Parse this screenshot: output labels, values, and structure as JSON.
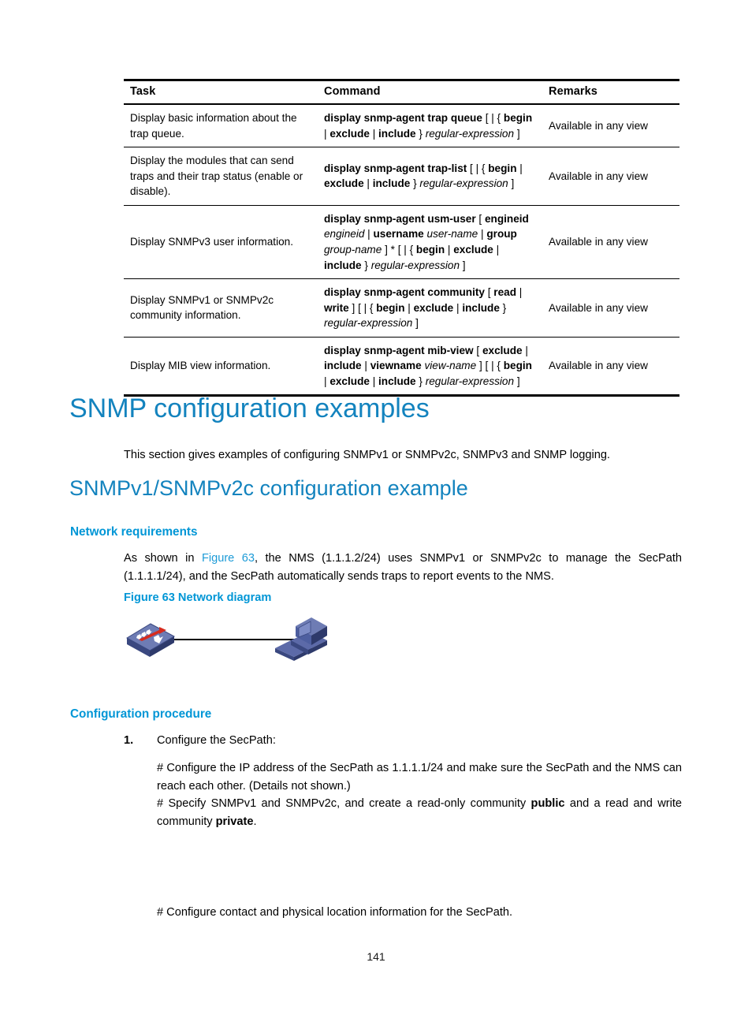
{
  "table": {
    "headers": [
      "Task",
      "Command",
      "Remarks"
    ],
    "rows": [
      {
        "task": "Display basic information about the trap queue.",
        "command_html": "<b>display snmp-agent trap queue</b> [ | { <b>begin</b> | <b>exclude</b> | <b>include</b> } <i>regular-expression</i> ]",
        "remarks": "Available in any view"
      },
      {
        "task": "Display the modules that can send traps and their trap status (enable or disable).",
        "command_html": "<b>display snmp-agent trap-list</b> [ | { <b>begin</b> | <b>exclude</b> | <b>include</b> } <i>regular-expression</i> ]",
        "remarks": "Available in any view"
      },
      {
        "task": "Display SNMPv3 user information.",
        "command_html": "<b>display snmp-agent usm-user</b> [ <b>engineid</b> <i>engineid</i> | <b>username</b> <i>user-name</i> | <b>group</b> <i>group-name</i> ] * [ | { <b>begin</b> | <b>exclude</b> | <b>include</b> } <i>regular-expression</i> ]",
        "remarks": "Available in any view"
      },
      {
        "task": "Display SNMPv1 or SNMPv2c community information.",
        "command_html": "<b>display snmp-agent community</b> [ <b>read</b> | <b>write</b> ] [ | { <b>begin</b> | <b>exclude</b> | <b>include</b> } <i>regular-expression</i> ]",
        "remarks": "Available in any view"
      },
      {
        "task": "Display MIB view information.",
        "command_html": "<b>display snmp-agent mib-view</b> [ <b>exclude</b> | <b>include</b> | <b>viewname</b> <i>view-name</i> ] [ | { <b>begin</b> | <b>exclude</b> | <b>include</b> } <i>regular-expression</i> ]",
        "remarks": "Available in any view"
      }
    ]
  },
  "headings": {
    "h1": "SNMP configuration examples",
    "h2": "SNMPv1/SNMPv2c configuration example",
    "network_requirements": "Network requirements",
    "configuration_procedure": "Configuration procedure"
  },
  "body": {
    "intro": "This section gives examples of configuring SNMPv1 or SNMPv2c, SNMPv3 and SNMP logging.",
    "requirements_html": "As shown in <span class=\"xref\">Figure 63</span>, the NMS (1.1.1.2/24) uses SNMPv1 or SNMPv2c to manage the SecPath (1.1.1.1/24), and the SecPath automatically sends traps to report events to the NMS.",
    "figure_caption": "Figure 63 Network diagram",
    "step_1_number": "1.",
    "step_1_text": "Configure the SecPath:",
    "sub_1": "# Configure the IP address of the SecPath as 1.1.1.1/24 and make sure the SecPath and the NMS can reach each other. (Details not shown.)",
    "sub_2_html": "# Specify SNMPv1 and SNMPv2c, and create a read-only community <b>public</b> and a read and write community <b>private</b>.",
    "sub_3": "# Configure contact and physical location information for the SecPath."
  },
  "figure": {
    "device_left": "router-firewall-icon",
    "device_right": "workstation-pc-icon",
    "link": "network-link-line"
  },
  "footer": {
    "page_number": "141"
  },
  "colors": {
    "heading_blue": "#1383BE",
    "subheading_blue": "#0096D6",
    "xref_blue": "#1D9BD7",
    "device_blue": "#4E5FA0",
    "device_accent_red": "#D62B1E"
  }
}
